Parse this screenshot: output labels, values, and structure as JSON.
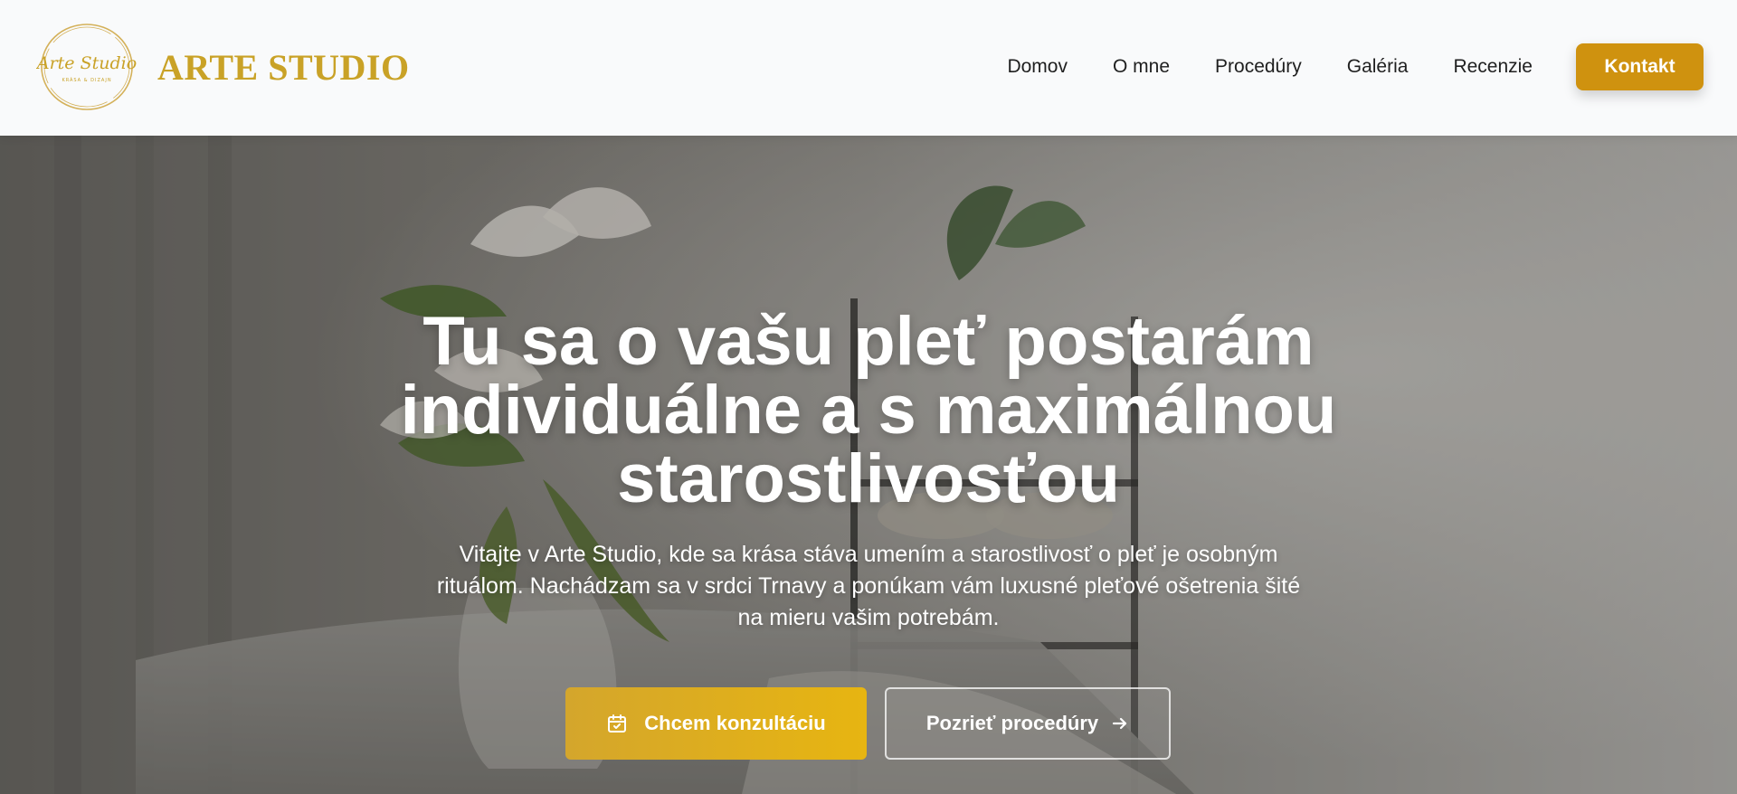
{
  "header": {
    "brand": "ARTE STUDIO",
    "logo_text": "Arte Studio",
    "logo_subtext": "KRÁSA & DIZAJN",
    "nav": [
      {
        "label": "Domov"
      },
      {
        "label": "O mne"
      },
      {
        "label": "Procedúry"
      },
      {
        "label": "Galéria"
      },
      {
        "label": "Recenzie"
      }
    ],
    "contact_label": "Kontakt"
  },
  "hero": {
    "title": "Tu sa o vašu pleť postarám individuálne a s maximálnou starostlivosťou",
    "text": "Vitajte v Arte Studio, kde sa krása stáva umením a starostlivosť o pleť je osobným rituálom. Nachádzam sa v srdci Trnavy a ponúkam vám luxusné pleťové ošetrenia šité na mieru vašim potrebám.",
    "primary_button": {
      "label": "Chcem konzultáciu",
      "icon": "calendar-icon"
    },
    "secondary_button": {
      "label": "Pozrieť procedúry",
      "icon": "arrow-right-icon"
    }
  },
  "colors": {
    "brand_gold": "#c9a227",
    "contact_button": "#cf920f",
    "primary_button": "#e7b511"
  }
}
